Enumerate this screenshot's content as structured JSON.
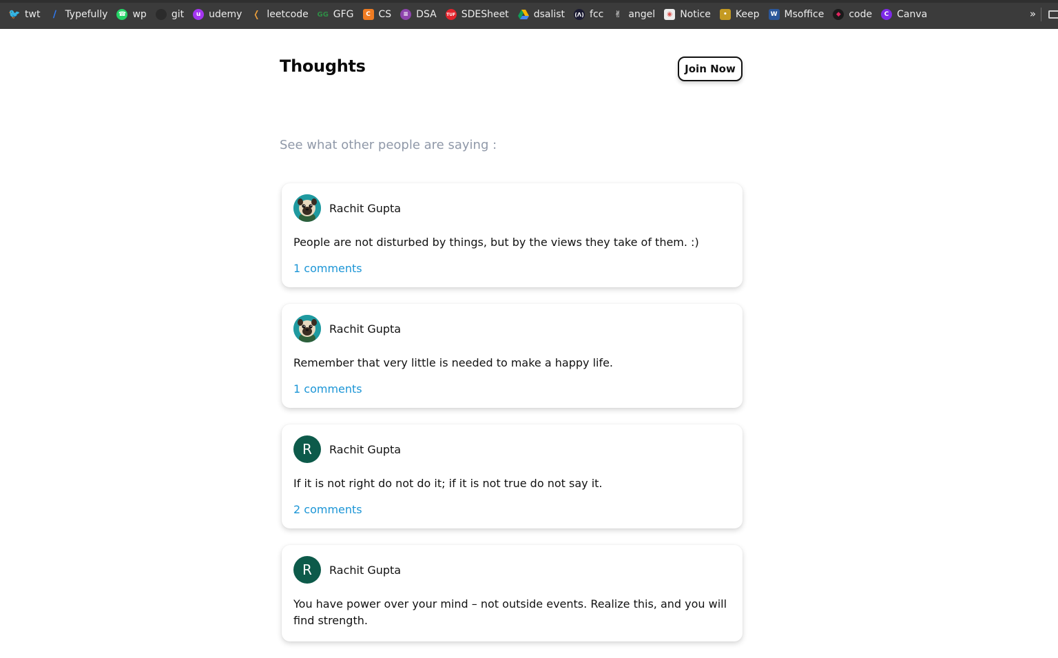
{
  "bookmarks": [
    {
      "label": "twt",
      "icon": "twitter-icon",
      "color": "#1d9bf0"
    },
    {
      "label": "Typefully",
      "icon": "typefully-icon",
      "color": "#2f7bf5"
    },
    {
      "label": "wp",
      "icon": "whatsapp-icon",
      "color": "#25d366"
    },
    {
      "label": "git",
      "icon": "github-icon",
      "color": "#2b2b2b"
    },
    {
      "label": "udemy",
      "icon": "udemy-icon",
      "color": "#a435f0"
    },
    {
      "label": "leetcode",
      "icon": "leetcode-icon",
      "color": "#f0a13b"
    },
    {
      "label": "GFG",
      "icon": "gfg-icon",
      "color": "#2f8d46"
    },
    {
      "label": "CS",
      "icon": "cs-icon",
      "color": "#f07c22"
    },
    {
      "label": "DSA",
      "icon": "dsa-icon",
      "color": "#8e44ad"
    },
    {
      "label": "SDESheet",
      "icon": "sdesheet-icon",
      "color": "#e3232c"
    },
    {
      "label": "dsalist",
      "icon": "google-drive-icon",
      "color": "#f4b400"
    },
    {
      "label": "fcc",
      "icon": "freecodecamp-icon",
      "color": "#1b1b32"
    },
    {
      "label": "angel",
      "icon": "angellist-icon",
      "color": "#3b3b3b"
    },
    {
      "label": "Notice",
      "icon": "notice-icon",
      "color": "#d9534f"
    },
    {
      "label": "Keep",
      "icon": "google-keep-icon",
      "color": "#c49a22"
    },
    {
      "label": "Msoffice",
      "icon": "ms-word-icon",
      "color": "#2b579a"
    },
    {
      "label": "code",
      "icon": "code-icon",
      "color": "#e0245e"
    },
    {
      "label": "Canva",
      "icon": "canva-icon",
      "color": "#7d2ae8"
    }
  ],
  "bookmarks_more": "»",
  "header": {
    "title": "Thoughts",
    "join_label": "Join Now"
  },
  "subtitle": "See what other people are saying :",
  "colors": {
    "link": "#1b95d6",
    "avatar_letter_bg": "#0d5a4a",
    "subtitle": "#8f98a8"
  },
  "posts": [
    {
      "author": "Rachit Gupta",
      "avatar": "pug-avatar",
      "text": "People are not disturbed by things, but by the views they take of them. :)",
      "comments": "1 comments"
    },
    {
      "author": "Rachit Gupta",
      "avatar": "pug-avatar",
      "text": "Remember that very little is needed to make a happy life.",
      "comments": "1 comments"
    },
    {
      "author": "Rachit Gupta",
      "avatar": "R",
      "text": "If it is not right do not do it; if it is not true do not say it.",
      "comments": "2 comments"
    },
    {
      "author": "Rachit Gupta",
      "avatar": "R",
      "text": "You have power over your mind – not outside events. Realize this, and you will find strength.",
      "comments": ""
    }
  ]
}
